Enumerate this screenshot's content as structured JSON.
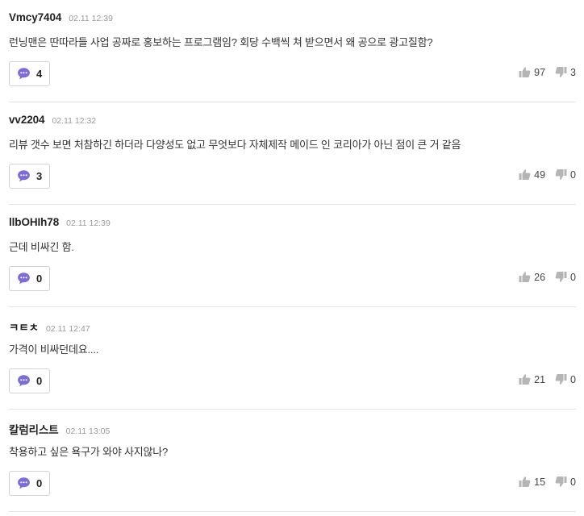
{
  "comments": [
    {
      "author": "Vmcy7404",
      "time": "02.11 12:39",
      "text": "런닝맨은 딴따라들 사업 공짜로 홍보하는 프로그램임? 회당 수백씩 쳐 받으면서 왜 공으로 광고질함?",
      "replies": "4",
      "likes": "97",
      "dislikes": "3"
    },
    {
      "author": "vv2204",
      "time": "02.11 12:32",
      "text": "리뷰 갯수 보면 처참하긴 하더라 다양성도 없고 무엇보다 자체제작 메이드 인 코리아가 아닌 점이 큰 거 같음",
      "replies": "3",
      "likes": "49",
      "dislikes": "0"
    },
    {
      "author": "llbOHIh78",
      "time": "02.11 12:39",
      "text": "근데 비싸긴 함.",
      "replies": "0",
      "likes": "26",
      "dislikes": "0"
    },
    {
      "author": "ㅋㅌㅊ",
      "time": "02.11 12:47",
      "text": "가격이 비싸던데요....",
      "replies": "0",
      "likes": "21",
      "dislikes": "0"
    },
    {
      "author": "칼럼리스트",
      "time": "02.11 13:05",
      "text": "착용하고 싶은 욕구가 와야 사지않나?",
      "replies": "0",
      "likes": "15",
      "dislikes": "0"
    }
  ],
  "icons": {
    "reply": "speech-bubble-icon",
    "like": "thumbs-up-icon",
    "dislike": "thumbs-down-icon"
  },
  "colors": {
    "reply_icon": "#7b6cd9",
    "vote_icon": "#b5b5b5",
    "divider": "#e3e3e3"
  }
}
